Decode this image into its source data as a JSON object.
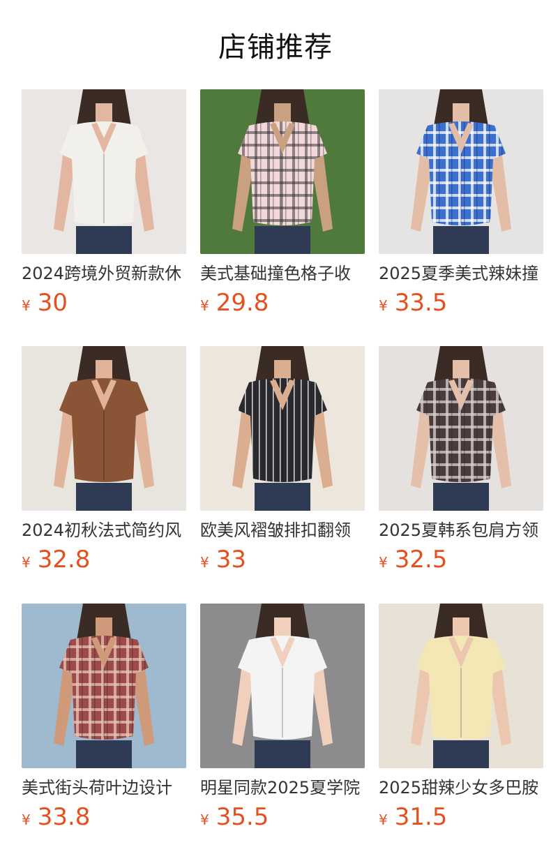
{
  "header": {
    "title": "店铺推荐"
  },
  "products": [
    {
      "title": "2024跨境外贸新款休",
      "currency": "¥",
      "price": "30",
      "bg": "#e9e6e3",
      "shirt": "#f1f0ea",
      "accent": "#3b2a23",
      "skin": "#e2b6a0",
      "pattern": "plain",
      "image": "product-photo-white-shirt"
    },
    {
      "title": "美式基础撞色格子收",
      "currency": "¥",
      "price": "29.8",
      "bg": "#4f7a3b",
      "shirt": "#f3d8d9",
      "accent": "#2a2a2e",
      "skin": "#c9a080",
      "pattern": "check",
      "image": "product-photo-pink-check-shirt"
    },
    {
      "title": "2025夏季美式辣妹撞",
      "currency": "¥",
      "price": "33.5",
      "bg": "#e6e4e2",
      "shirt": "#3b6fd0",
      "accent": "#ffffff",
      "skin": "#e3bda6",
      "pattern": "plaid",
      "image": "product-photo-blue-plaid-shirt"
    },
    {
      "title": "2024初秋法式简约风",
      "currency": "¥",
      "price": "32.8",
      "bg": "#e8e5df",
      "shirt": "#8a5537",
      "accent": "#3a2a22",
      "skin": "#e1b49a",
      "pattern": "plain",
      "image": "product-photo-brown-shirt"
    },
    {
      "title": "欧美风褶皱排扣翻领",
      "currency": "¥",
      "price": "33",
      "bg": "#ece6dd",
      "shirt": "#2a2a2e",
      "accent": "#d8d8d8",
      "skin": "#dcae90",
      "pattern": "stripe",
      "image": "product-photo-black-stripe-shirt"
    },
    {
      "title": "2025夏韩系包肩方领",
      "currency": "¥",
      "price": "32.5",
      "bg": "#e4e1df",
      "shirt": "#4a3c3e",
      "accent": "#d9d2cf",
      "skin": "#e4c0aa",
      "pattern": "plaid",
      "image": "product-photo-brown-plaid-top"
    },
    {
      "title": "美式街头荷叶边设计",
      "currency": "¥",
      "price": "33.8",
      "bg": "#9fb9cf",
      "shirt": "#9c4b4a",
      "accent": "#e6c7b5",
      "skin": "#cf9a7a",
      "pattern": "plaid",
      "image": "product-photo-red-plaid-top"
    },
    {
      "title": "明星同款2025夏学院",
      "currency": "¥",
      "price": "35.5",
      "bg": "#8c8b8e",
      "shirt": "#f4f4f4",
      "accent": "#dedede",
      "skin": "#f0d0bd",
      "pattern": "plain",
      "image": "product-photo-white-collar-shirt"
    },
    {
      "title": "2025甜辣少女多巴胺",
      "currency": "¥",
      "price": "31.5",
      "bg": "#e8e2d6",
      "shirt": "#f3e7b6",
      "accent": "#c9b98a",
      "skin": "#ecc6ae",
      "pattern": "plain",
      "image": "product-photo-yellow-shirt"
    }
  ]
}
